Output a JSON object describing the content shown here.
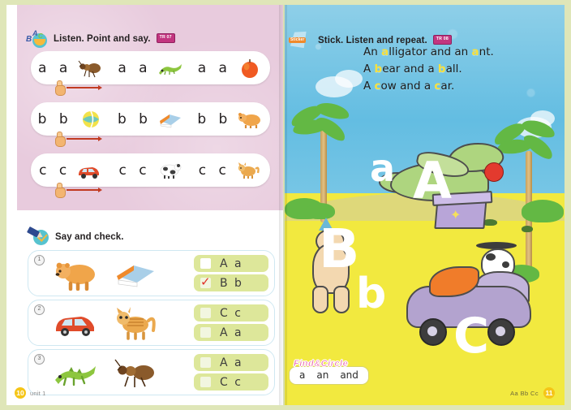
{
  "book": {
    "left_page": {
      "page_number": "10",
      "unit_label": "unit 1",
      "activity_1": {
        "icon": "abc-icon",
        "title": "Listen. Point and say.",
        "audio_badge": "TR 07",
        "rows": [
          {
            "letters_1": "a a",
            "picture_1": "ant-picture",
            "letters_2": "a a",
            "picture_2": "alligator-picture",
            "letters_3": "a a",
            "picture_3": "apple-picture"
          },
          {
            "letters_1": "b b",
            "picture_1": "ball-picture",
            "letters_2": "b b",
            "picture_2": "book-picture",
            "letters_3": "b b",
            "picture_3": "bear-picture"
          },
          {
            "letters_1": "c c",
            "picture_1": "car-picture",
            "letters_2": "c c",
            "picture_2": "cow-picture",
            "letters_3": "c c",
            "picture_3": "cat-picture"
          }
        ]
      },
      "activity_2": {
        "icon": "pencil-check-icon",
        "title": "Say and check.",
        "rows": [
          {
            "number": "1",
            "picture_1": "bear-picture",
            "picture_2": "book-picture",
            "options": [
              {
                "label": "A a",
                "checked": false
              },
              {
                "label": "B b",
                "checked": true
              }
            ]
          },
          {
            "number": "2",
            "picture_1": "car-picture",
            "picture_2": "cat-picture",
            "options": [
              {
                "label": "C c",
                "checked": false
              },
              {
                "label": "A a",
                "checked": false
              }
            ]
          },
          {
            "number": "3",
            "picture_1": "alligator-picture",
            "picture_2": "ant-picture",
            "options": [
              {
                "label": "A a",
                "checked": false
              },
              {
                "label": "C c",
                "checked": false
              }
            ]
          }
        ]
      }
    },
    "right_page": {
      "page_number": "11",
      "footer_letters": "Aa Bb Cc",
      "activity": {
        "icon": "sticker-icon",
        "sticker_tag": "Sticker",
        "title": "Stick. Listen and repeat.",
        "audio_badge": "TR 08"
      },
      "rhyme": [
        {
          "pre": "An ",
          "hl": "a",
          "post": "lligator and an ",
          "hl2": "a",
          "post2": "nt."
        },
        {
          "pre": "A ",
          "hl": "b",
          "post": "ear and a ",
          "hl2": "b",
          "post2": "all."
        },
        {
          "pre": "A ",
          "hl": "c",
          "post": "ow and a ",
          "hl2": "c",
          "post2": "ar."
        }
      ],
      "sticker_letters": [
        "a",
        "A",
        "B",
        "b",
        "C"
      ],
      "find_circle": {
        "banner": "Find&Circle",
        "words": [
          "a",
          "an",
          "and"
        ]
      }
    }
  },
  "colors": {
    "pink_panel": "#e8cbdd",
    "sky": "#63bde2",
    "ground": "#f2e93f",
    "option_green": "#dde79a",
    "accent_teal": "#57c3cf",
    "highlight_yellow": "#f7e03d",
    "page_number_yellow": "#f5c518",
    "audio_badge": "#c2357f",
    "red_check": "#e03127"
  }
}
